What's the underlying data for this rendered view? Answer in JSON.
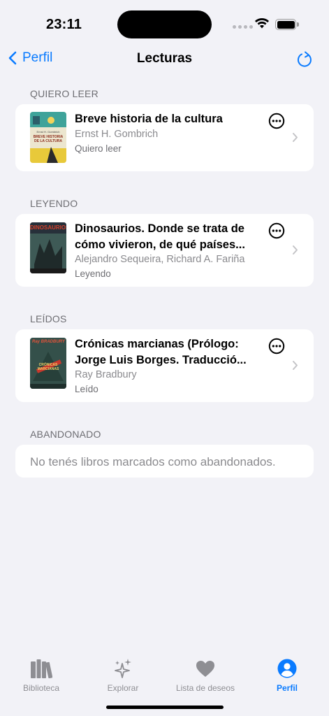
{
  "status_bar": {
    "time": "23:11"
  },
  "nav": {
    "back_label": "Perfil",
    "title": "Lecturas"
  },
  "sections": [
    {
      "header": "QUIERO LEER",
      "book": {
        "title": "Breve historia de la cultura",
        "author": "Ernst H. Gombrich",
        "status": "Quiero leer"
      }
    },
    {
      "header": "LEYENDO",
      "book": {
        "title": "Dinosaurios. Donde se trata de cómo vivieron, de qué países...",
        "author": "Alejandro Sequeira, Richard A. Fariña",
        "status": "Leyendo"
      }
    },
    {
      "header": "LEÍDOS",
      "book": {
        "title": "Crónicas marcianas (Prólogo: Jorge Luis Borges. Traducció...",
        "author": "Ray Bradbury",
        "status": "Leído"
      }
    },
    {
      "header": "ABANDONADO",
      "empty": "No tenés libros marcados como abandonados."
    }
  ],
  "covers": {
    "gombrich": {
      "author": "Ernst H. Gombrich",
      "title": "BREVE HISTORIA DE LA CULTURA"
    },
    "dinosaurios": {
      "title": "DINOSAURIOS"
    },
    "bradbury": {
      "author": "Ray BRADBURY",
      "title": "CRÓNICAS MARCIANAS"
    }
  },
  "tabs": [
    {
      "label": "Biblioteca",
      "icon": "books-icon",
      "active": false
    },
    {
      "label": "Explorar",
      "icon": "sparkles-icon",
      "active": false
    },
    {
      "label": "Lista de deseos",
      "icon": "heart-icon",
      "active": false
    },
    {
      "label": "Perfil",
      "icon": "person-circle-icon",
      "active": true
    }
  ],
  "colors": {
    "accent": "#0a7bff",
    "background": "#f2f2f7",
    "card": "#ffffff",
    "secondary_text": "#8a8a8e"
  }
}
